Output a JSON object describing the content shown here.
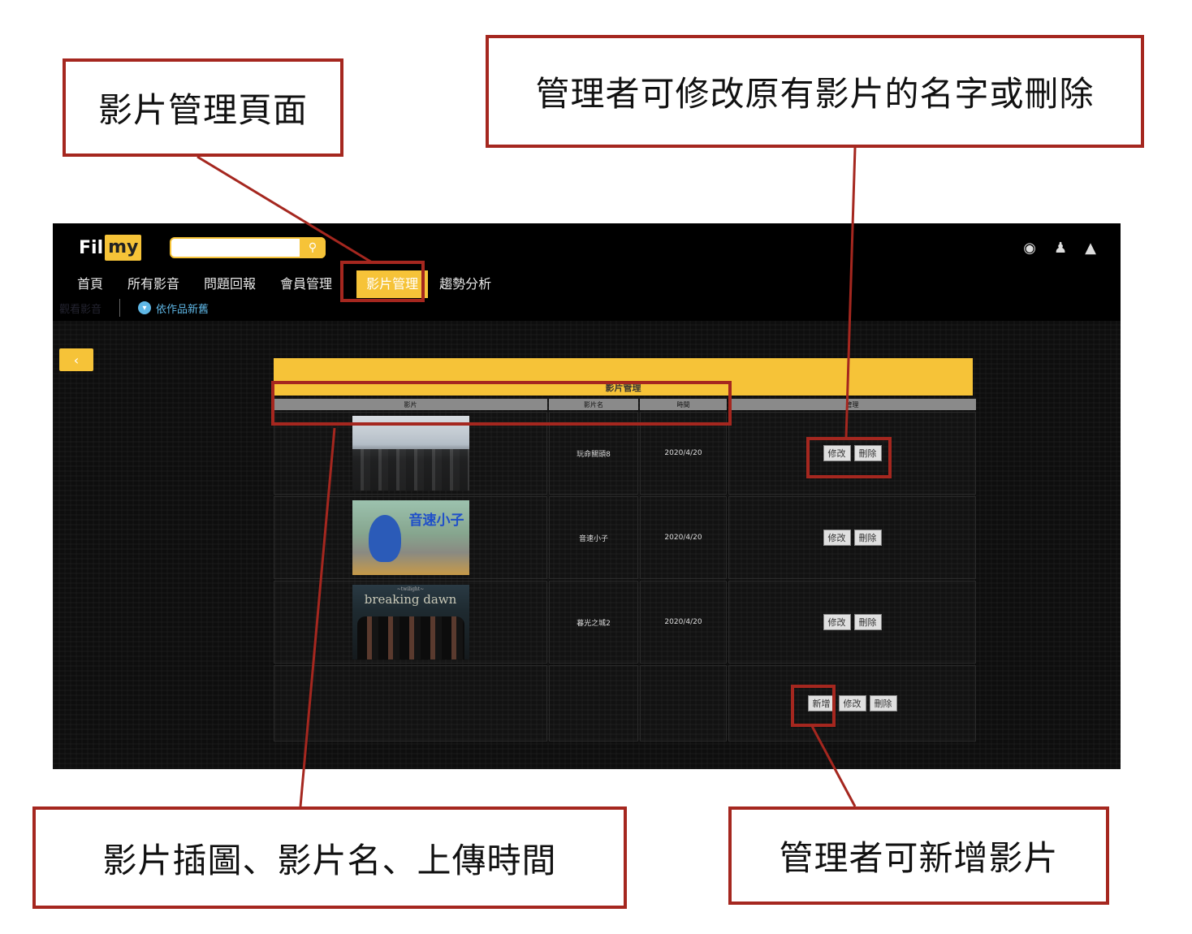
{
  "annotations": {
    "page_label": "影片管理頁面",
    "edit_delete_label": "管理者可修改原有影片的名字或刪除",
    "columns_label": "影片插圖、影片名、上傳時間",
    "add_label": "管理者可新增影片"
  },
  "app": {
    "logo_part1": "Fil",
    "logo_part2": "my",
    "search": {
      "placeholder": ""
    },
    "top_icons": [
      "volume-icon",
      "user-icon",
      "thumbs-up-icon"
    ]
  },
  "nav": {
    "items": [
      "首頁",
      "所有影音",
      "問題回報",
      "會員管理",
      "影片管理",
      "趨勢分析"
    ],
    "active": "影片管理"
  },
  "subnav": {
    "faint_label": "觀看影音",
    "sort_label": "依作品新舊"
  },
  "panel": {
    "title": "影片管理",
    "headers": [
      "影片",
      "影片名",
      "時間",
      "管理"
    ],
    "rows": [
      {
        "name": "玩命關頭8",
        "time": "2020/4/20",
        "thumb": "fast-furious-8-poster"
      },
      {
        "name": "音速小子",
        "time": "2020/4/20",
        "thumb": "sonic-poster",
        "poster_text": "音速小子"
      },
      {
        "name": "暮光之城2",
        "time": "2020/4/20",
        "thumb": "twilight-breaking-dawn-poster",
        "poster_text": "breaking dawn",
        "poster_small": "~twilight~"
      }
    ],
    "buttons": {
      "edit": "修改",
      "delete": "刪除",
      "add": "新增"
    }
  },
  "colors": {
    "accent": "#f6c338",
    "highlight_red": "#a5271f",
    "background": "#0e0e0e"
  }
}
